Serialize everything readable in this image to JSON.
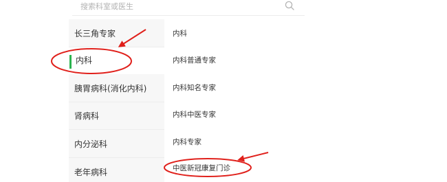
{
  "search": {
    "placeholder": "搜索科室或医生",
    "icon": "search-icon"
  },
  "sidebar": {
    "active_color": "#2bb34f",
    "items": [
      {
        "label": "长三角专家",
        "active": false
      },
      {
        "label": "内科",
        "active": true
      },
      {
        "label": "胰胃病科(消化内科)",
        "active": false
      },
      {
        "label": "肾病科",
        "active": false
      },
      {
        "label": "内分泌科",
        "active": false
      },
      {
        "label": "老年病科",
        "active": false
      }
    ]
  },
  "content": {
    "items": [
      {
        "label": "内科"
      },
      {
        "label": "内科普通专家"
      },
      {
        "label": "内科知名专家"
      },
      {
        "label": "内科中医专家"
      },
      {
        "label": "内科专家"
      },
      {
        "label": "中医新冠康复门诊"
      }
    ]
  },
  "annotations": {
    "color": "#e0201b"
  }
}
